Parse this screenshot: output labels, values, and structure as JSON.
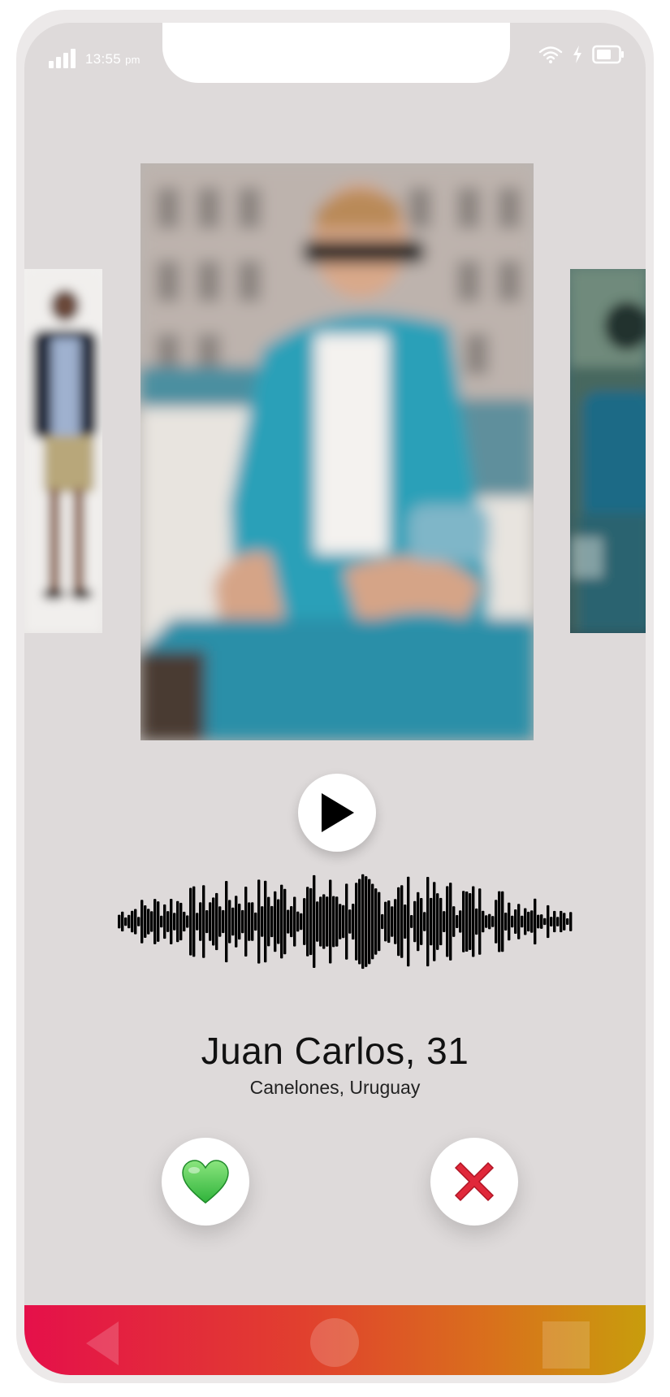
{
  "status_bar": {
    "time": "13:55",
    "time_suffix": "pm",
    "icons": [
      "signal-icon",
      "wifi-icon",
      "charging-icon",
      "battery-icon"
    ]
  },
  "profile": {
    "name": "Juan Carlos, 31",
    "location": "Canelones, Uruguay"
  },
  "audio": {
    "play_icon": "play-icon"
  },
  "actions": {
    "like_icon": "green-heart-icon",
    "dislike_icon": "red-x-icon"
  },
  "nav": {
    "icons": [
      "back-icon",
      "home-icon",
      "recent-apps-icon"
    ]
  },
  "colors": {
    "screen_bg": "#dedada",
    "nav_gradient_start": "#e5104a",
    "nav_gradient_end": "#c89d0c",
    "like_green": "#5fd35a",
    "dislike_red": "#e0283a"
  }
}
